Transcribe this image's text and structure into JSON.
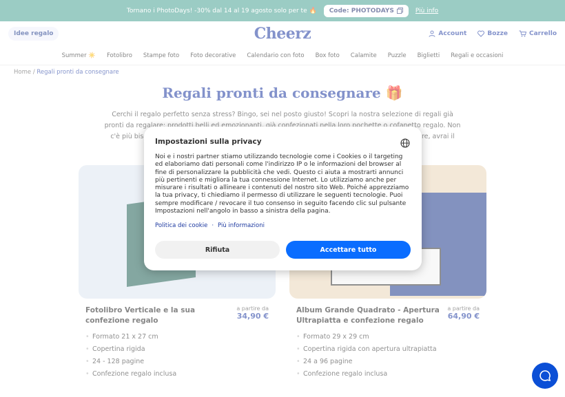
{
  "promo": {
    "text": "Tornano i PhotoDays! -30% dal 14 al 19 agosto solo per te 🔥",
    "code": "Code: PHOTODAYS",
    "more": "Più info"
  },
  "header": {
    "gift_ideas": "Idee regalo",
    "logo": "Cheerz",
    "account": "Account",
    "favorites": "Bozze",
    "cart": "Carrello"
  },
  "nav": [
    "Summer ☀️",
    "Fotolibro",
    "Stampe foto",
    "Foto decorative",
    "Calendario con foto",
    "Box foto",
    "Calamite",
    "Puzzle",
    "Biglietti",
    "Regali e occasioni"
  ],
  "breadcrumb": {
    "home": "Home",
    "sep": "/",
    "current": "Regali pronti da consegnare"
  },
  "page": {
    "title": "Regali pronti da consegnare 🎁",
    "intro": "Cerchi il regalo perfetto senza stress? Bingo, sei nel posto giusto! Scopri la nostra selezione di regali già pronti da regalare: prodotti belli ed emozionanti, già confezionati nella loro pochette o cofanetto regalo. Non c'è più bisogno di correre nei negozi all'ultimo minuto: grazie ai nostri prodotti pronti da regalare, avrai il piacere di regalare il"
  },
  "products": [
    {
      "name": "Fotolibro Verticale e la sua confezione regalo",
      "price_label": "a partire da",
      "price": "34,90 €",
      "features": [
        "Formato 21 x 27 cm",
        "Copertina rigida",
        "24 - 128 pagine",
        "Confezione regalo inclusa"
      ]
    },
    {
      "name": "Album Grande Quadrato - Apertura Ultrapiatta e confezione regalo",
      "price_label": "a partire da",
      "price": "64,90 €",
      "features": [
        "Formato 29 x 29 cm",
        "Copertina rigida con apertura ultrapiatta",
        "24 a 96 pagine",
        "Confezione regalo inclusa"
      ]
    }
  ],
  "modal": {
    "title": "Impostazioni sulla privacy",
    "body": "Noi e i nostri partner stiamo utilizzando tecnologie come i Cookies o il targeting ed elaboriamo dati personali come l'indirizzo IP o le informazioni del browser al fine di personalizzare la pubblicità che vedi. Questo ci aiuta a mostrarti annunci più pertinenti e migliora la tua connessione Internet. Lo utilizziamo anche per misurare i risultati o allineare i contenuti del nostro sito Web. Poiché apprezziamo la tua privacy, ti chiediamo il permesso di utilizzare le seguenti tecnologie. Puoi sempre modificare / revocare il tuo consenso in seguito facendo clic sul pulsante Impostazioni nell'angolo in basso a sinistra della pagina.",
    "cookie_policy": "Politica dei cookie",
    "separator": "·",
    "more_info": "Più informazioni",
    "reject": "Rifiuta",
    "accept": "Accettare tutto"
  },
  "colors": {
    "promo_bg": "#4aa394",
    "brand": "#1e3aa0",
    "accept": "#0a6dff"
  }
}
